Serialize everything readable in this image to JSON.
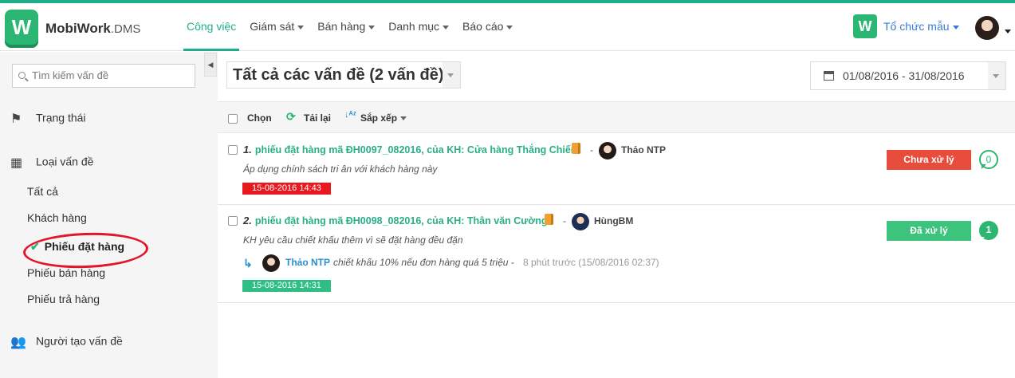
{
  "app": {
    "logo_letter": "W",
    "brand_name": "MobiWork",
    "brand_suffix": ".DMS",
    "accent_color": "#1fae8c"
  },
  "nav": {
    "items": [
      {
        "label": "Công việc",
        "active": true,
        "dropdown": false
      },
      {
        "label": "Giám sát",
        "dropdown": true
      },
      {
        "label": "Bán hàng",
        "dropdown": true
      },
      {
        "label": "Danh mục",
        "dropdown": true
      },
      {
        "label": "Báo cáo",
        "dropdown": true
      }
    ]
  },
  "org": {
    "icon_letter": "W",
    "name": "Tổ chức mẫu"
  },
  "sidebar": {
    "collapse_glyph": "◀",
    "search_placeholder": "Tìm kiếm vấn đề",
    "status_heading": "Trạng thái",
    "type_heading": "Loại vấn đề",
    "types": [
      "Tất cả",
      "Khách hàng",
      "Phiếu đặt hàng",
      "Phiếu bán hàng",
      "Phiếu trả hàng"
    ],
    "selected_type": "Phiếu đặt hàng",
    "creator_heading": "Người tạo vấn đề"
  },
  "main": {
    "title": "Tất cả các vấn đề (2 vấn đề)",
    "date_range": "01/08/2016 - 31/08/2016"
  },
  "toolbar": {
    "select_label": "Chọn",
    "reload_label": "Tải lại",
    "sort_label": "Sắp xếp",
    "reload_icon": "refresh-icon",
    "sort_icon": "sort-alpha-icon"
  },
  "issues": [
    {
      "number": "1.",
      "title": "phiếu đặt hàng mã ĐH0097_082016, của KH: Cửa hàng Thắng Chiến",
      "separator": "-",
      "author": "Thảo NTP",
      "description": "Áp dụng chính sách tri ân với khách hàng này",
      "date": "15-08-2016 14:43",
      "date_color": "#e7191f",
      "status": "Chưa xử lý",
      "status_color": "#e84c3d",
      "comment_count": "0"
    },
    {
      "number": "2.",
      "title": "phiếu đặt hàng mã ĐH0098_082016, của KH: Thân văn Cường",
      "separator": "-",
      "author": "HùngBM",
      "description": "KH yêu cầu chiết khấu thêm vì sẽ đặt hàng đều đặn",
      "reply": {
        "author": "Thảo NTP",
        "text": "chiết khấu 10% nếu đơn hàng quá 5 triệu -",
        "time": "8 phút trước (15/08/2016 02:37)"
      },
      "date": "15-08-2016 14:31",
      "date_color": "#2fbf85",
      "status": "Đã xử lý",
      "status_color": "#3cc47c",
      "comment_count": "1"
    }
  ]
}
